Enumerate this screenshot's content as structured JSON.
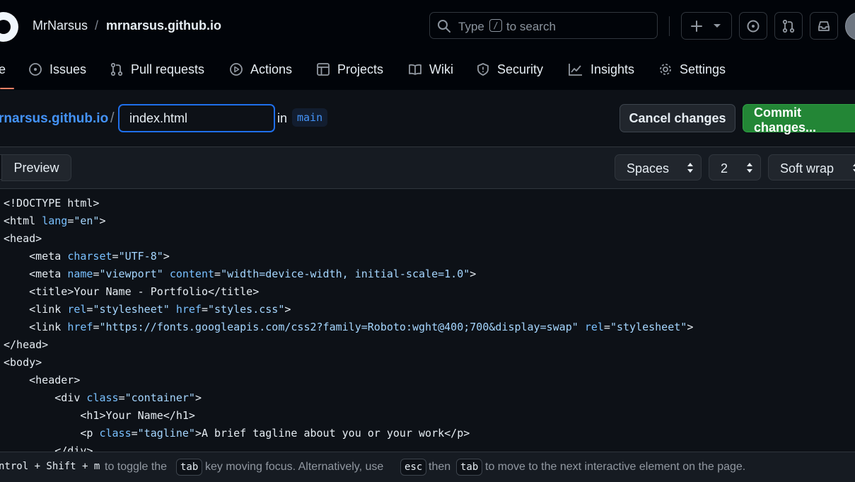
{
  "header": {
    "owner": "MrNarsus",
    "separator": "/",
    "repo": "mrnarsus.github.io",
    "search": {
      "prefix": "Type",
      "key": "/",
      "suffix": "to search"
    }
  },
  "tabs": [
    {
      "label": "e",
      "icon": "code-icon"
    },
    {
      "label": "Issues",
      "icon": "issue-icon"
    },
    {
      "label": "Pull requests",
      "icon": "pull-request-icon"
    },
    {
      "label": "Actions",
      "icon": "play-icon"
    },
    {
      "label": "Projects",
      "icon": "table-icon"
    },
    {
      "label": "Wiki",
      "icon": "book-icon"
    },
    {
      "label": "Security",
      "icon": "shield-icon"
    },
    {
      "label": "Insights",
      "icon": "graph-icon"
    },
    {
      "label": "Settings",
      "icon": "gear-icon"
    }
  ],
  "editor": {
    "repo_link": "rnarsus.github.io",
    "path_sep": "/",
    "filename": "index.html",
    "in_label": "in",
    "branch": "main",
    "cancel_label": "Cancel changes",
    "commit_label": "Commit changes..."
  },
  "toolbar": {
    "preview_label": "Preview",
    "indent_mode": "Spaces",
    "indent_size": "2",
    "wrap_mode": "Soft wrap"
  },
  "status": {
    "shortcut": "ntrol + Shift + m",
    "text1": "to toggle the",
    "key_tab": "tab",
    "text2": "key moving focus. Alternatively, use",
    "key_esc": "esc",
    "text3": "then",
    "text4": "to move to the next interactive element on the page."
  },
  "colors": {
    "accent": "#4493f8",
    "commit": "#238636",
    "tab_underline": "#f78166"
  },
  "code_lines": [
    [
      {
        "t": "<!DOCTYPE html>",
        "c": ""
      }
    ],
    [
      {
        "t": "<html ",
        "c": ""
      },
      {
        "t": "lang",
        "c": "attr"
      },
      {
        "t": "=",
        "c": ""
      },
      {
        "t": "\"en\"",
        "c": "str"
      },
      {
        "t": ">",
        "c": ""
      }
    ],
    [
      {
        "t": "<head>",
        "c": ""
      }
    ],
    [
      {
        "t": "    <meta ",
        "c": ""
      },
      {
        "t": "charset",
        "c": "attr"
      },
      {
        "t": "=",
        "c": ""
      },
      {
        "t": "\"UTF-8\"",
        "c": "str"
      },
      {
        "t": ">",
        "c": ""
      }
    ],
    [
      {
        "t": "    <meta ",
        "c": ""
      },
      {
        "t": "name",
        "c": "attr"
      },
      {
        "t": "=",
        "c": ""
      },
      {
        "t": "\"viewport\"",
        "c": "str"
      },
      {
        "t": " ",
        "c": ""
      },
      {
        "t": "content",
        "c": "attr"
      },
      {
        "t": "=",
        "c": ""
      },
      {
        "t": "\"width=device-width, initial-scale=1.0\"",
        "c": "str"
      },
      {
        "t": ">",
        "c": ""
      }
    ],
    [
      {
        "t": "    <title>Your Name - Portfolio</title>",
        "c": ""
      }
    ],
    [
      {
        "t": "    <link ",
        "c": ""
      },
      {
        "t": "rel",
        "c": "attr"
      },
      {
        "t": "=",
        "c": ""
      },
      {
        "t": "\"stylesheet\"",
        "c": "str"
      },
      {
        "t": " ",
        "c": ""
      },
      {
        "t": "href",
        "c": "attr"
      },
      {
        "t": "=",
        "c": ""
      },
      {
        "t": "\"styles.css\"",
        "c": "str"
      },
      {
        "t": ">",
        "c": ""
      }
    ],
    [
      {
        "t": "    <link ",
        "c": ""
      },
      {
        "t": "href",
        "c": "attr"
      },
      {
        "t": "=",
        "c": ""
      },
      {
        "t": "\"https://fonts.googleapis.com/css2?family=Roboto:wght@400;700&display=swap\"",
        "c": "str"
      },
      {
        "t": " ",
        "c": ""
      },
      {
        "t": "rel",
        "c": "attr"
      },
      {
        "t": "=",
        "c": ""
      },
      {
        "t": "\"stylesheet\"",
        "c": "str"
      },
      {
        "t": ">",
        "c": ""
      }
    ],
    [
      {
        "t": "</head>",
        "c": ""
      }
    ],
    [
      {
        "t": "<body>",
        "c": ""
      }
    ],
    [
      {
        "t": "    <header>",
        "c": ""
      }
    ],
    [
      {
        "t": "        <div ",
        "c": ""
      },
      {
        "t": "class",
        "c": "attr"
      },
      {
        "t": "=",
        "c": ""
      },
      {
        "t": "\"container\"",
        "c": "str"
      },
      {
        "t": ">",
        "c": ""
      }
    ],
    [
      {
        "t": "            <h1>Your Name</h1>",
        "c": ""
      }
    ],
    [
      {
        "t": "            <p ",
        "c": ""
      },
      {
        "t": "class",
        "c": "attr"
      },
      {
        "t": "=",
        "c": ""
      },
      {
        "t": "\"tagline\"",
        "c": "str"
      },
      {
        "t": ">A brief tagline about you or your work</p>",
        "c": ""
      }
    ],
    [
      {
        "t": "        </div>",
        "c": ""
      }
    ]
  ]
}
